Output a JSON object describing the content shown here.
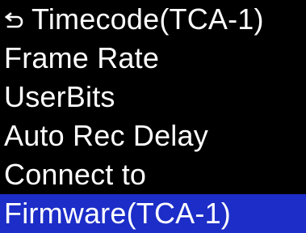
{
  "header": {
    "back_icon": "return-arrow-icon",
    "title": "Timecode(TCA-1)"
  },
  "menu": {
    "items": [
      {
        "label": "Frame Rate"
      },
      {
        "label": "UserBits"
      },
      {
        "label": "Auto Rec Delay"
      },
      {
        "label": "Connect to"
      },
      {
        "label": "Firmware(TCA-1)",
        "selected": true
      }
    ]
  },
  "colors": {
    "background": "#000000",
    "text": "#ffffff",
    "selection": "#1c2dc8"
  }
}
